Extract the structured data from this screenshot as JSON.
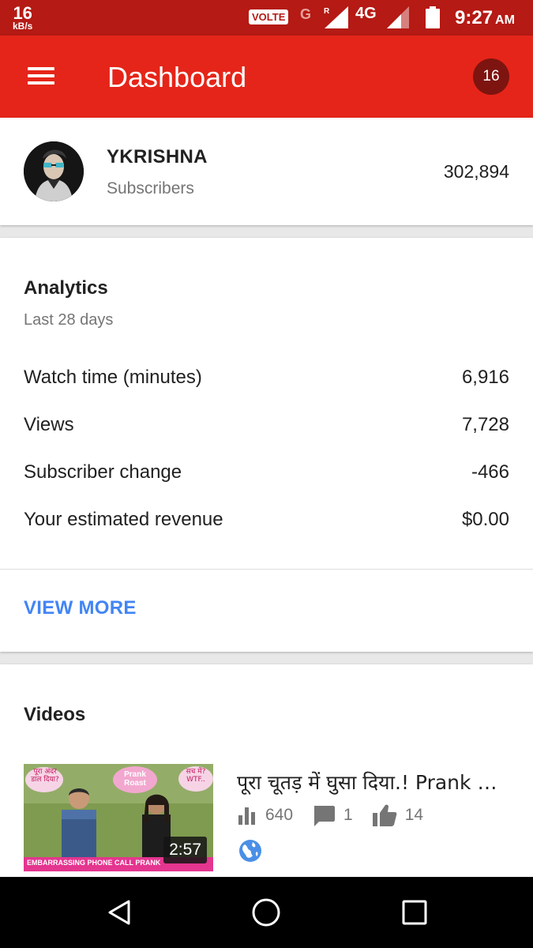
{
  "status_bar": {
    "speed_value": "16",
    "speed_unit": "kB/s",
    "volte": "VOLTE",
    "carrier_g": "G",
    "roaming": "R",
    "network": "4G",
    "time": "9:27",
    "ampm": "AM"
  },
  "app_bar": {
    "title": "Dashboard",
    "notification_count": "16",
    "accent_color": "#e52519"
  },
  "channel": {
    "name": "YKRISHNA",
    "subscribers_label": "Subscribers",
    "subscribers_count": "302,894"
  },
  "analytics": {
    "title": "Analytics",
    "period": "Last 28 days",
    "metrics": [
      {
        "label": "Watch time (minutes)",
        "value": "6,916"
      },
      {
        "label": "Views",
        "value": "7,728"
      },
      {
        "label": "Subscriber change",
        "value": "-466"
      },
      {
        "label": "Your estimated revenue",
        "value": "$0.00"
      }
    ],
    "view_more": "VIEW MORE",
    "link_color": "#4285f4"
  },
  "videos": {
    "title": "Videos",
    "items": [
      {
        "title": "पूरा चूतड़ में घुसा दिया.! Prank Roast",
        "duration": "2:57",
        "views": "640",
        "comments": "1",
        "likes": "14",
        "visibility_icon": "globe-icon",
        "thumbnail_texts": [
          "पूरा अंदर डाल दिया?",
          "Prank Roast",
          "सच में? WTF..",
          "EMBARRASSING PHONE CALL PRANK"
        ]
      }
    ]
  },
  "nav_bar": {
    "icons": [
      "back-icon",
      "home-icon",
      "recents-icon"
    ]
  }
}
